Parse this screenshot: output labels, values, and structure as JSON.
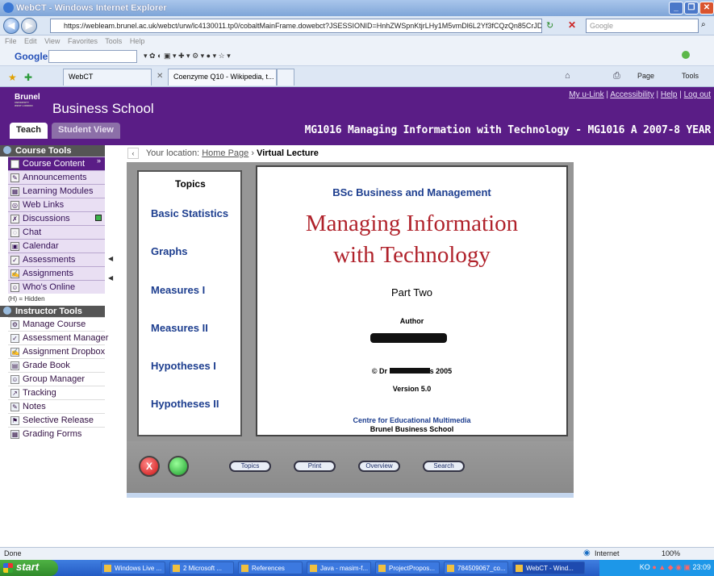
{
  "browser": {
    "title": "WebCT - Windows Internet Explorer",
    "url": "https://webleam.brunel.ac.uk/webct/urw/lc4130011.tp0/cobaltMainFrame.dowebct?JSESSIONID=HnhZWSpnKtjrLHy1M5vmDl6L2Yf3fCQzQn85CrJDSQKJMJfpyLrx!-1989170021w",
    "search_placeholder": "Google",
    "menu": [
      "File",
      "Edit",
      "View",
      "Favorites",
      "Tools",
      "Help"
    ],
    "google_label": "Google",
    "tabs": [
      "WebCT",
      "Coenzyme Q10 - Wikipedia, t..."
    ],
    "toolbar_right": [
      "Page",
      "Tools"
    ],
    "status_left": "Done",
    "status_zone": "Internet",
    "zoom": "100%"
  },
  "header": {
    "logo_text": "Brunel",
    "logo_sub": "UNIVERSITY WEST LONDON",
    "school": "Business School",
    "links": [
      "My u-Link",
      "Accessibility",
      "Help",
      "Log out"
    ],
    "link_sep": "|",
    "tab_teach": "Teach",
    "tab_student": "Student View",
    "course_title": "MG1016 Managing Information with Technology - MG1016 A 2007-8 YEAR"
  },
  "sidebar": {
    "course_tools_header": "Course Tools",
    "course_tools": [
      "Course Content",
      "Announcements",
      "Learning Modules",
      "Web Links",
      "Discussions",
      "Chat",
      "Calendar",
      "Assessments",
      "Assignments",
      "Who's Online"
    ],
    "hidden_note": "(H) = Hidden",
    "instructor_tools_header": "Instructor Tools",
    "instructor_tools": [
      "Manage Course",
      "Assessment Manager",
      "Assignment Dropbox",
      "Grade Book",
      "Group Manager",
      "Tracking",
      "Notes",
      "Selective Release",
      "Grading Forms"
    ]
  },
  "location": {
    "prefix": "Your location:",
    "home": "Home Page",
    "sep": "›",
    "current": "Virtual Lecture"
  },
  "lecture": {
    "topics_header": "Topics",
    "topics": [
      "Basic Statistics",
      "Graphs",
      "Measures I",
      "Measures II",
      "Hypotheses I",
      "Hypotheses II"
    ],
    "program": "BSc Business and Management",
    "title_line1": "Managing Information",
    "title_line2": "with Technology",
    "part": "Part Two",
    "author_label": "Author",
    "copyright_prefix": "© Dr",
    "copyright_suffix": "s 2005",
    "version": "Version 5.0",
    "centre": "Centre for Educational Multimedia",
    "school": "Brunel Business School",
    "buttons": [
      "Topics",
      "Print",
      "Overview",
      "Search"
    ],
    "close_glyph": "X"
  },
  "taskbar": {
    "start": "start",
    "items": [
      "Windows Live ...",
      "2 Microsoft ...",
      "References",
      "Java - masim-f...",
      "ProjectPropos...",
      "784509067_co...",
      "WebCT - Wind..."
    ],
    "tray_lang": "KO",
    "clock": "23:09"
  }
}
